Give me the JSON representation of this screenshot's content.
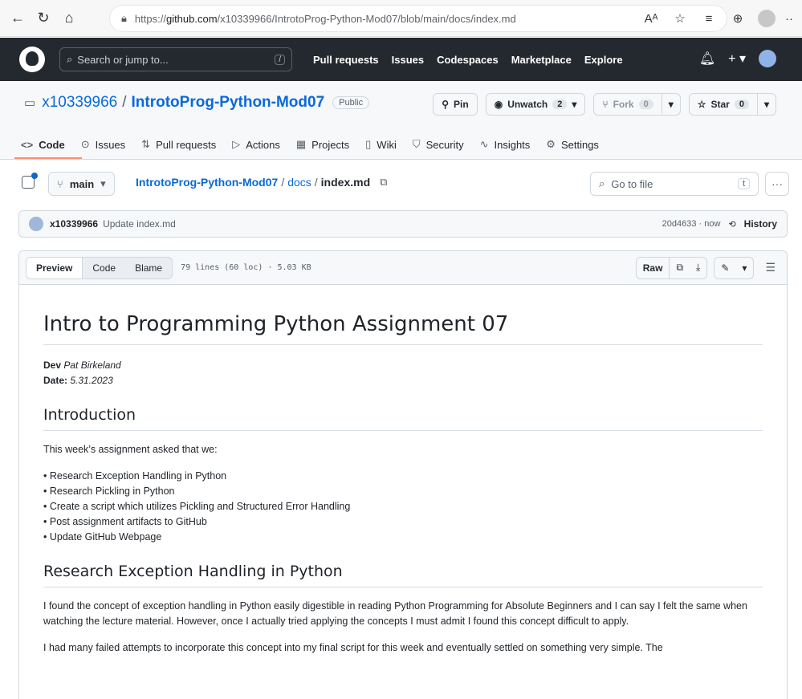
{
  "browser": {
    "url_prefix": "https://",
    "url_host": "github.com",
    "url_path": "/x10339966/IntrotoProg-Python-Mod07/blob/main/docs/index.md",
    "icons": [
      "back-icon",
      "refresh-icon",
      "home-icon",
      "lock-icon",
      "read-aloud-icon",
      "favorites-add-icon",
      "favorites-icon",
      "collections-icon",
      "profile-icon",
      "more-icon"
    ]
  },
  "github": {
    "search_placeholder": "Search or jump to...",
    "search_shortcut": "/",
    "nav": [
      "Pull requests",
      "Issues",
      "Codespaces",
      "Marketplace",
      "Explore"
    ],
    "plus_label": "+ ▾"
  },
  "repo": {
    "owner": "x10339966",
    "separator": "/",
    "name": "IntrotoProg-Python-Mod07",
    "visibility": "Public",
    "pin_label": "Pin",
    "unwatch_label": "Unwatch",
    "unwatch_count": "2",
    "fork_label": "Fork",
    "fork_count": "0",
    "star_label": "Star",
    "star_count": "0",
    "tabs": [
      {
        "label": "Code",
        "icon": "<>"
      },
      {
        "label": "Issues",
        "icon": "⊙"
      },
      {
        "label": "Pull requests",
        "icon": "⇅"
      },
      {
        "label": "Actions",
        "icon": "▷"
      },
      {
        "label": "Projects",
        "icon": "▦"
      },
      {
        "label": "Wiki",
        "icon": "▯"
      },
      {
        "label": "Security",
        "icon": "⛉"
      },
      {
        "label": "Insights",
        "icon": "∿"
      },
      {
        "label": "Settings",
        "icon": "⚙"
      }
    ]
  },
  "file_nav": {
    "branch": "main",
    "crumb_repo": "IntrotoProg-Python-Mod07",
    "crumb_dir": "docs",
    "crumb_file": "index.md",
    "goto_placeholder": "Go to file",
    "goto_key": "t"
  },
  "commit": {
    "user": "x10339966",
    "message": "Update index.md",
    "sha_time": "20d4633 · now",
    "history": "History"
  },
  "file_header": {
    "views": [
      "Preview",
      "Code",
      "Blame"
    ],
    "meta": "79 lines (60 loc) · 5.03 KB",
    "raw": "Raw"
  },
  "doc": {
    "title": "Intro to Programming Python Assignment 07",
    "dev_label": "Dev",
    "dev_value": "Pat Birkeland",
    "date_label": "Date:",
    "date_value": "5.31.2023",
    "intro_heading": "Introduction",
    "intro_text": "This week’s assignment asked that we:",
    "bullets": [
      "Research Exception Handling in Python",
      "Research Pickling in Python",
      "Create a script which utilizes Pickling and Structured Error Handling",
      "Post assignment artifacts to GitHub",
      "Update GitHub Webpage"
    ],
    "section_heading": "Research Exception Handling in Python",
    "para1": "I found the concept of exception handling in Python easily digestible in reading Python Programming for Absolute Beginners and I can say I felt the same when watching the lecture material. However, once I actually tried applying the concepts I must admit I found this concept difficult to apply.",
    "para2": "I had many failed attempts to incorporate this concept into my final script for this week and eventually settled on something very simple. The"
  },
  "colors": {
    "header_bg": "#24292f",
    "link": "#0969da",
    "tab_underline": "#fd8c73"
  }
}
